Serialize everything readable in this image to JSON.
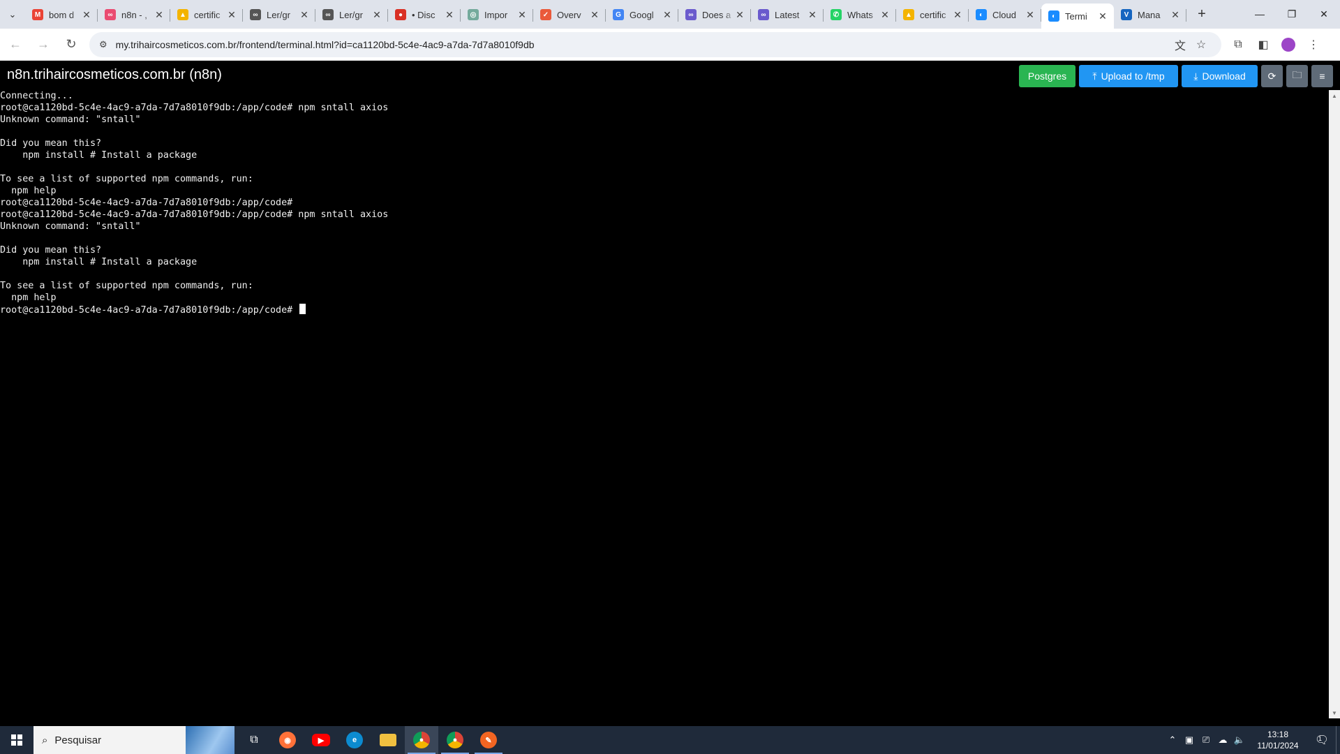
{
  "browser": {
    "tabs": [
      {
        "title": "bom d",
        "icon": "gmail-icon",
        "color": "#ea4335",
        "glyph": "M"
      },
      {
        "title": "n8n - ,",
        "icon": "n8n-icon",
        "color": "#ea4b71",
        "glyph": "∞"
      },
      {
        "title": "certific",
        "icon": "google-drive-icon",
        "color": "#f4b400",
        "glyph": "▲"
      },
      {
        "title": "Ler/gr",
        "icon": "n8n-icon",
        "color": "#555555",
        "glyph": "∞"
      },
      {
        "title": "Ler/gr",
        "icon": "n8n-icon",
        "color": "#555555",
        "glyph": "∞"
      },
      {
        "title": "• Disc",
        "icon": "discord-icon",
        "color": "#d93025",
        "glyph": "●"
      },
      {
        "title": "Impor",
        "icon": "openai-icon",
        "color": "#74aa9c",
        "glyph": "◎"
      },
      {
        "title": "Overv",
        "icon": "overview-icon",
        "color": "#ea5a3b",
        "glyph": "✓"
      },
      {
        "title": "Googl",
        "icon": "google-translate-icon",
        "color": "#4285f4",
        "glyph": "G"
      },
      {
        "title": "Does a",
        "icon": "n8n-community-icon",
        "color": "#6a5acd",
        "glyph": "∞"
      },
      {
        "title": "Latest",
        "icon": "n8n-community-icon",
        "color": "#6a5acd",
        "glyph": "∞"
      },
      {
        "title": "Whats",
        "icon": "whatsapp-icon",
        "color": "#25d366",
        "glyph": "✆"
      },
      {
        "title": "certific",
        "icon": "google-drive-icon",
        "color": "#f4b400",
        "glyph": "▲"
      },
      {
        "title": "Cloud",
        "icon": "cloud-icon",
        "color": "#1a8cff",
        "glyph": "◐"
      },
      {
        "title": "Termi",
        "icon": "terminal-icon",
        "color": "#1a8cff",
        "glyph": "◐",
        "active": true
      },
      {
        "title": "Mana",
        "icon": "manager-icon",
        "color": "#1565c0",
        "glyph": "V"
      }
    ],
    "url": "my.trihaircosmeticos.com.br/frontend/terminal.html?id=ca1120bd-5c4e-4ac9-a7da-7d7a8010f9db"
  },
  "page": {
    "title": "n8n.trihaircosmeticos.com.br (n8n)",
    "buttons": {
      "postgres": "Postgres",
      "upload": "Upload to /tmp",
      "download": "Download"
    }
  },
  "terminal": {
    "lines": [
      "Connecting...",
      "root@ca1120bd-5c4e-4ac9-a7da-7d7a8010f9db:/app/code# npm sntall axios",
      "Unknown command: \"sntall\"",
      "",
      "Did you mean this?",
      "    npm install # Install a package",
      "",
      "To see a list of supported npm commands, run:",
      "  npm help",
      "root@ca1120bd-5c4e-4ac9-a7da-7d7a8010f9db:/app/code#",
      "root@ca1120bd-5c4e-4ac9-a7da-7d7a8010f9db:/app/code# npm sntall axios",
      "Unknown command: \"sntall\"",
      "",
      "Did you mean this?",
      "    npm install # Install a package",
      "",
      "To see a list of supported npm commands, run:",
      "  npm help"
    ],
    "prompt": "root@ca1120bd-5c4e-4ac9-a7da-7d7a8010f9db:/app/code# "
  },
  "taskbar": {
    "search_placeholder": "Pesquisar",
    "time": "13:18",
    "date": "11/01/2024",
    "notification_count": "1"
  }
}
